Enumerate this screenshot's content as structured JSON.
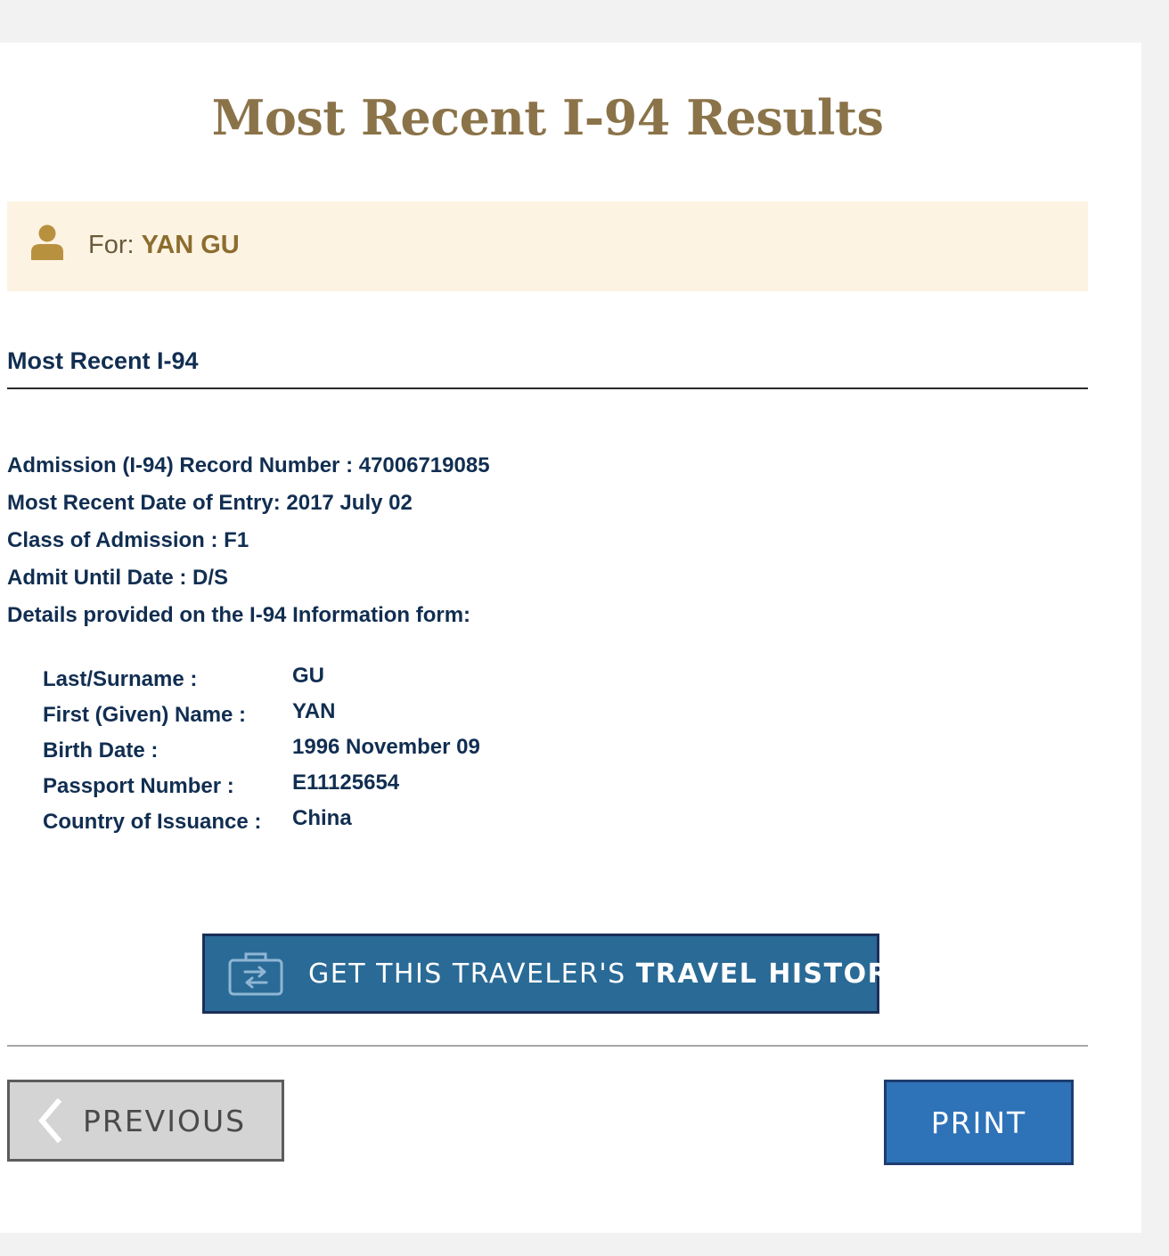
{
  "page": {
    "title": "Most Recent I-94 Results"
  },
  "traveler": {
    "for_label": "For:",
    "name": "YAN GU",
    "icon": "person-icon"
  },
  "section": {
    "heading": "Most Recent I-94"
  },
  "record": {
    "record_number_line": "Admission (I-94) Record Number : 47006719085",
    "date_of_entry_line": "Most Recent Date of Entry: 2017 July 02",
    "class_of_admission_line": "Class of Admission : F1",
    "admit_until_line": "Admit Until Date : D/S",
    "details_intro_line": "Details provided on the I-94 Information form:"
  },
  "details": [
    {
      "label": "Last/Surname :",
      "value": "GU"
    },
    {
      "label": "First (Given) Name :",
      "value": "YAN"
    },
    {
      "label": "Birth Date :",
      "value": "1996 November 09"
    },
    {
      "label": "Passport Number :",
      "value": "E11125654"
    },
    {
      "label": "Country of Issuance :",
      "value": "China"
    }
  ],
  "travel_history_button": {
    "label_prefix": "GET THIS TRAVELER'S",
    "label_strong": "TRAVEL HISTORY",
    "icon": "travel-suitcase-icon"
  },
  "navigation": {
    "previous_label": "PREVIOUS",
    "previous_icon": "chevron-left-icon",
    "print_label": "PRINT"
  },
  "colors": {
    "title": "#8b7349",
    "banner_bg": "#fcf3e3",
    "text_navy": "#112e51",
    "travel_button_bg": "#2a6a96",
    "print_button_bg": "#2e72b8",
    "previous_button_bg": "#d4d4d4"
  }
}
